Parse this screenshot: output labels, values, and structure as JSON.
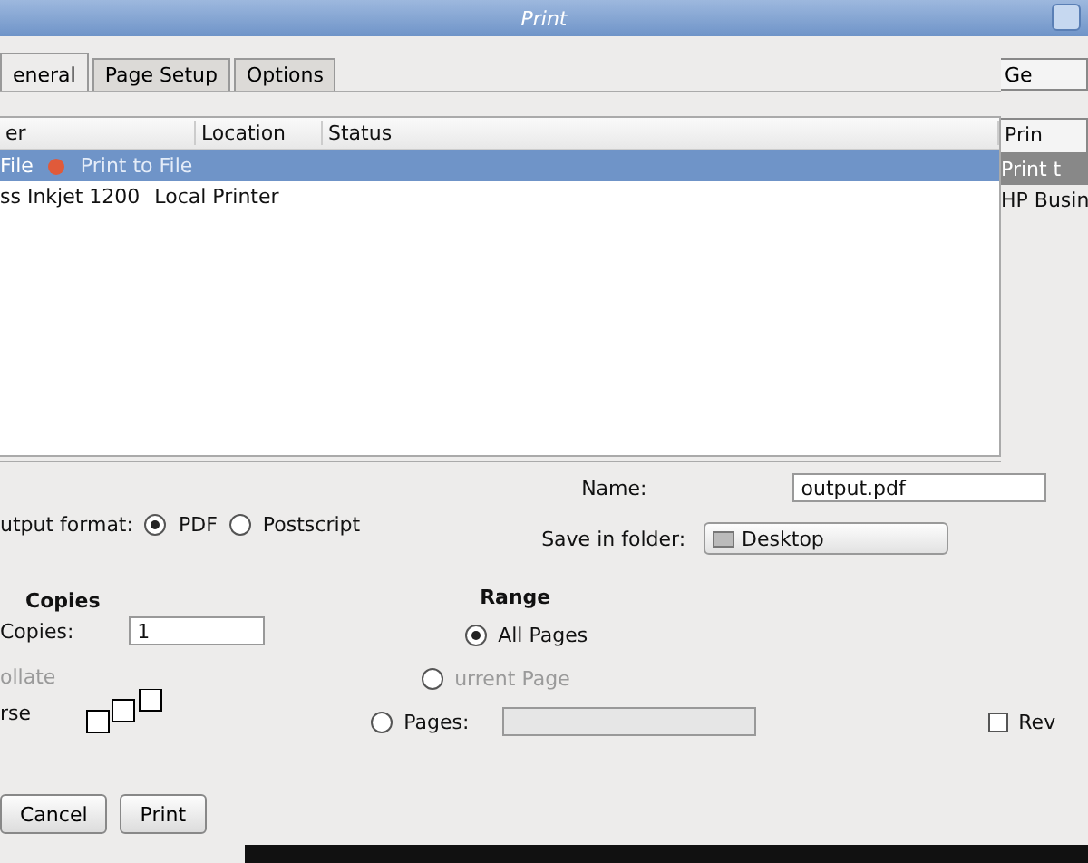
{
  "window": {
    "title": "Print"
  },
  "tabs": [
    {
      "label": "eneral",
      "selected": true
    },
    {
      "label": "Page Setup",
      "selected": false
    },
    {
      "label": "Options",
      "selected": false
    }
  ],
  "printer_list": {
    "columns": [
      "er",
      "Location",
      "Status"
    ],
    "rows": [
      {
        "kind": "file",
        "name": "File",
        "detail": "Print to File",
        "selected": true
      },
      {
        "kind": "printer",
        "name": "ss Inkjet 1200",
        "detail": "Local Printer",
        "selected": false
      }
    ]
  },
  "side_panel": {
    "button": "Ge",
    "header": "Prin",
    "items": [
      {
        "label": "Print t",
        "selected": true
      },
      {
        "label": "HP Busin",
        "selected": false
      }
    ]
  },
  "output_format": {
    "label": "utput format:",
    "options": [
      {
        "label": "PDF",
        "selected": true
      },
      {
        "label": "Postscript",
        "selected": false
      }
    ]
  },
  "file": {
    "name_label": "Name:",
    "name_value": "output.pdf",
    "folder_label": "Save in folder:",
    "folder": "Desktop"
  },
  "copies": {
    "title": "Copies",
    "label": "Copies:",
    "value": "1",
    "collate": {
      "label": "ollate",
      "disabled": true
    },
    "reverse": {
      "label": "rse"
    }
  },
  "range": {
    "title": "Range",
    "options": [
      {
        "kind": "all",
        "label": "All Pages",
        "selected": true,
        "disabled": false
      },
      {
        "kind": "current",
        "label": "urrent Page",
        "selected": false,
        "disabled": true
      },
      {
        "kind": "pages",
        "label": "Pages:",
        "selected": false,
        "disabled": false
      }
    ]
  },
  "reverse_right": {
    "label": "Rev",
    "checked": false
  },
  "buttons": [
    "Cancel",
    "Print"
  ]
}
